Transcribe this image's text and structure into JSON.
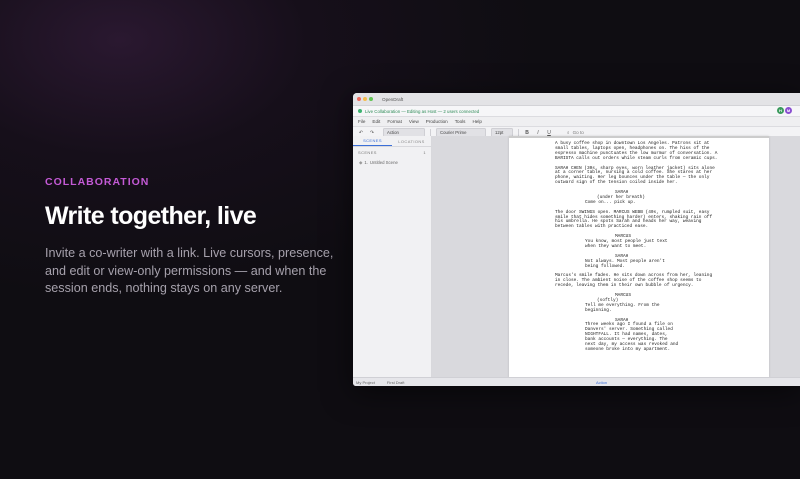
{
  "hero": {
    "eyebrow": "COLLABORATION",
    "headline": "Write together, live",
    "description": "Invite a co-writer with a link. Live cursors, presence, and edit or view-only permissions — and when the session ends, nothing stays on any server."
  },
  "app": {
    "title": "OpenDraft",
    "collab_status": "Live Collaboration — Editing as Host — 2 users connected",
    "avatars": [
      "H",
      "M"
    ],
    "menu": [
      "File",
      "Edit",
      "Format",
      "View",
      "Production",
      "Tools",
      "Help"
    ],
    "toolbar": {
      "element_type": "Action",
      "font": "Courier Prime",
      "font_size": "12pt",
      "bold": "B",
      "italic": "I",
      "underline": "U",
      "goto_placeholder": "Go to"
    },
    "sidebar": {
      "tabs": [
        "SCENES",
        "LOCATIONS"
      ],
      "section_label": "SCENES",
      "section_count": "1",
      "scenes": [
        {
          "number": "1.",
          "title": "Untitled Scene"
        }
      ]
    },
    "status": {
      "project": "My Project",
      "draft": "First Draft",
      "page": "Action"
    },
    "colors": {
      "live": "#3cb371",
      "accent": "#3b6fd8",
      "eyebrow": "#c45ad6"
    }
  },
  "script": [
    {
      "type": "action",
      "text": "A busy coffee shop in downtown Los Angeles. Patrons sit at\nsmall tables, laptops open, headphones on. The hiss of the\nespresso machine punctuates the low murmur of conversation. A\nBARISTA calls out orders while steam curls from ceramic cups."
    },
    {
      "type": "action",
      "text": "SARAH CHEN (30s, sharp eyes, worn leather jacket) sits alone\nat a corner table, nursing a cold coffee. She stares at her\nphone, waiting. Her leg bounces under the table — the only\noutward sign of the tension coiled inside her."
    },
    {
      "type": "dialogue",
      "character": "SARAH",
      "paren": "(under her breath)",
      "line": "Come on... pick up."
    },
    {
      "type": "action",
      "text": "The door SWINGS open. MARCUS WEBB (40s, rumpled suit, easy\nsmile that hides something harder) enters, shaking rain off\nhis umbrella. He spots Sarah and heads her way, weaving\nbetween tables with practiced ease."
    },
    {
      "type": "dialogue",
      "character": "MARCUS",
      "paren": "",
      "line": "You know, most people just text\nwhen they want to meet."
    },
    {
      "type": "dialogue",
      "character": "SARAH",
      "paren": "",
      "line": "Not always. Most people aren't\nbeing followed."
    },
    {
      "type": "action",
      "text": "Marcus's smile fades. He sits down across from her, leaning\nin close. The ambient noise of the coffee shop seems to\nrecede, leaving them in their own bubble of urgency."
    },
    {
      "type": "dialogue",
      "character": "MARCUS",
      "paren": "(softly)",
      "line": "Tell me everything. From the\nbeginning."
    },
    {
      "type": "dialogue",
      "character": "SARAH",
      "paren": "",
      "line": "Three weeks ago I found a file on\nDanvers' server. Something called\nNIGHTFALL. It had names, dates,\nbank accounts — everything. The\nnext day, my access was revoked and\nsomeone broke into my apartment."
    }
  ]
}
